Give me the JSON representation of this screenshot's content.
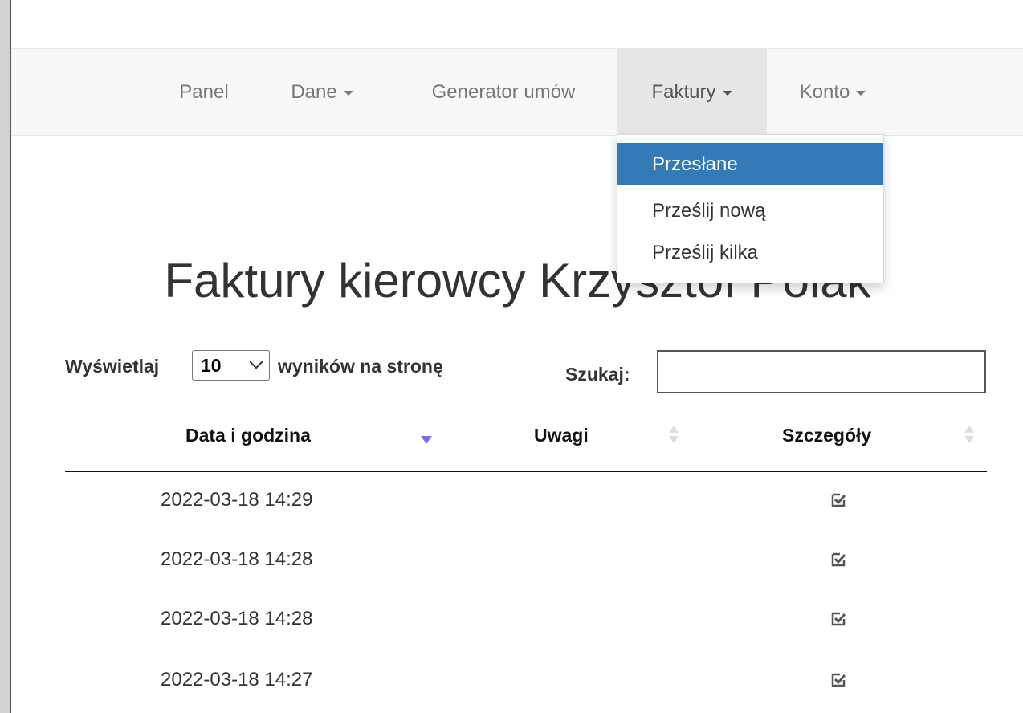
{
  "nav": {
    "items": [
      {
        "label": "Panel",
        "dropdown": false
      },
      {
        "label": "Dane",
        "dropdown": true
      },
      {
        "label": "Generator umów",
        "dropdown": false
      },
      {
        "label": "Faktury",
        "dropdown": true,
        "active": true
      },
      {
        "label": "Konto",
        "dropdown": true
      }
    ],
    "faktury_menu": {
      "items": [
        "Przesłane",
        "Prześlij nową",
        "Prześlij kilka"
      ],
      "selected": "Przesłane"
    }
  },
  "page": {
    "title": "Faktury kierowcy Krzysztof Polak"
  },
  "table_controls": {
    "show_label_before": "Wyświetlaj",
    "page_size": "10",
    "show_label_after": "wyników na stronę",
    "search_label": "Szukaj:",
    "search_value": ""
  },
  "table": {
    "columns": [
      "Data i godzina",
      "Uwagi",
      "Szczegóły"
    ],
    "sorted_column": "Data i godzina",
    "sort_direction": "descending",
    "rows": [
      {
        "date": "2022-03-18 14:29",
        "notes": "",
        "detail_icon": "check-square-edit-icon"
      },
      {
        "date": "2022-03-18 14:28",
        "notes": "",
        "detail_icon": "check-square-edit-icon"
      },
      {
        "date": "2022-03-18 14:28",
        "notes": "",
        "detail_icon": "check-square-edit-icon"
      },
      {
        "date": "2022-03-18 14:27",
        "notes": "",
        "detail_icon": "check-square-edit-icon"
      }
    ]
  },
  "colors": {
    "navbar_bg": "#f8f8f8",
    "active_nav_bg": "#e7e7e7",
    "dropdown_selected": "#337ab7",
    "sort_indicator": "#7373e6"
  }
}
